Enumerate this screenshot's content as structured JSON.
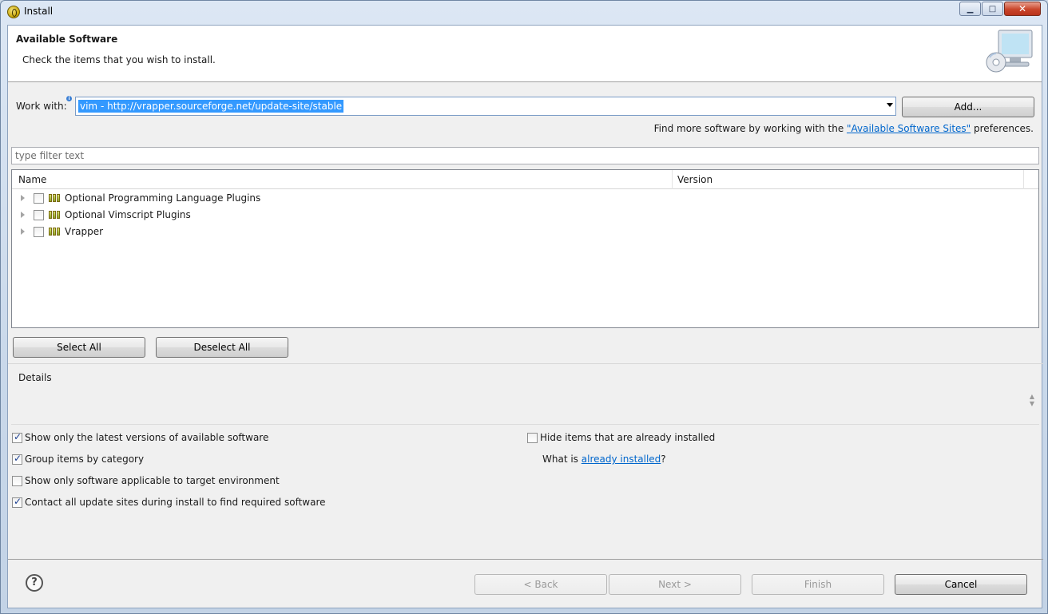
{
  "window": {
    "title": "Install",
    "minimize_label": "▁",
    "maximize_label": "□",
    "close_label": "✕"
  },
  "header": {
    "title": "Available Software",
    "description": "Check the items that you wish to install."
  },
  "work_with": {
    "label": "Work with:",
    "value": "vim - http://vrapper.sourceforge.net/update-site/stable",
    "add_button": "Add..."
  },
  "find_more": {
    "prefix": "Find more software by working with the ",
    "link": "\"Available Software Sites\"",
    "suffix": " preferences."
  },
  "filter": {
    "placeholder": "type filter text"
  },
  "table": {
    "columns": [
      "Name",
      "Version"
    ],
    "rows": [
      {
        "label": "Optional Programming Language Plugins",
        "checked": false
      },
      {
        "label": "Optional Vimscript Plugins",
        "checked": false
      },
      {
        "label": "Vrapper",
        "checked": false
      }
    ]
  },
  "selection_buttons": {
    "select_all": "Select All",
    "deselect_all": "Deselect All"
  },
  "details": {
    "label": "Details"
  },
  "options": {
    "latest_versions": {
      "label": "Show only the latest versions of available software",
      "checked": true
    },
    "group_by_category": {
      "label": "Group items by category",
      "checked": true
    },
    "target_env": {
      "label": "Show only software applicable to target environment",
      "checked": false
    },
    "contact_sites": {
      "label": "Contact all update sites during install to find required software",
      "checked": true
    },
    "hide_installed": {
      "label": "Hide items that are already installed",
      "checked": false
    }
  },
  "already_installed": {
    "prefix": "What is ",
    "link": "already installed",
    "suffix": "?"
  },
  "footer": {
    "help": "?",
    "back": "< Back",
    "next": "Next >",
    "finish": "Finish",
    "cancel": "Cancel"
  }
}
